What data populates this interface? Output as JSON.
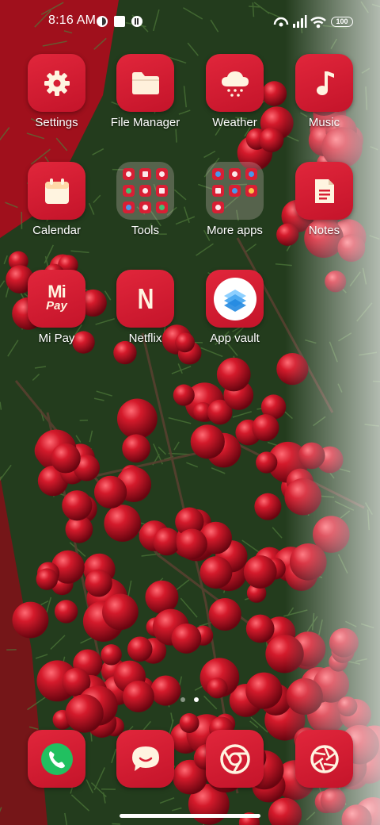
{
  "status_bar": {
    "time": "8:16 AM",
    "notification_icons": [
      "app-circle-icon",
      "square-app-icon",
      "app-circle-icon"
    ],
    "right_icons": [
      "hotspot-icon",
      "cellular-signal-icon",
      "wifi-icon"
    ],
    "battery_level": "100"
  },
  "apps": [
    {
      "label": "Settings",
      "icon": "gear-icon"
    },
    {
      "label": "File Manager",
      "icon": "folder-icon"
    },
    {
      "label": "Weather",
      "icon": "cloud-snow-icon"
    },
    {
      "label": "Music",
      "icon": "music-note-icon"
    },
    {
      "label": "Calendar",
      "icon": "calendar-icon"
    },
    {
      "label": "Tools",
      "icon": "folder-preview-icon"
    },
    {
      "label": "More apps",
      "icon": "folder-preview-icon"
    },
    {
      "label": "Notes",
      "icon": "note-icon"
    },
    {
      "label": "Mi Pay",
      "icon": "mi-pay-icon",
      "glyph_top": "Mi",
      "glyph_bottom": "Pay"
    },
    {
      "label": "Netflix",
      "icon": "netflix-icon",
      "glyph": "N"
    },
    {
      "label": "App vault",
      "icon": "app-vault-icon"
    }
  ],
  "pager": {
    "page_count": 2,
    "current_page": 2
  },
  "dock": [
    {
      "name": "phone",
      "icon": "phone-icon"
    },
    {
      "name": "messages",
      "icon": "chat-bubble-icon"
    },
    {
      "name": "chrome",
      "icon": "chrome-icon"
    },
    {
      "name": "camera",
      "icon": "camera-shutter-icon"
    }
  ],
  "colors": {
    "tile": "#d81f34",
    "wallpaper_green": "#1f3a1d",
    "berry": "#b3121f"
  }
}
